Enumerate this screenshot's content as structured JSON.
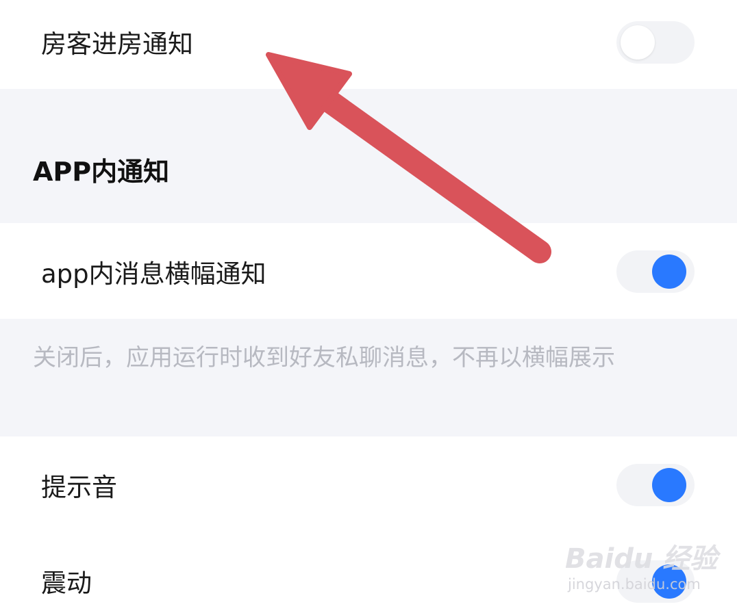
{
  "rows": {
    "guest_checkin": {
      "label": "房客进房通知",
      "toggle": "off"
    },
    "banner": {
      "label": "app内消息横幅通知",
      "toggle": "on"
    },
    "sound": {
      "label": "提示音",
      "toggle": "on"
    },
    "vibrate": {
      "label": "震动",
      "toggle": "on"
    }
  },
  "section": {
    "title": "APP内通知"
  },
  "hint": {
    "text": "关闭后，应用运行时收到好友私聊消息，不再以横幅展示"
  },
  "overlay": {
    "arrow_icon": "red-arrow-icon",
    "arrow_color": "#d9535a"
  },
  "watermark": {
    "brand": "Baidu 经验",
    "url": "jingyan.baidu.com"
  },
  "colors": {
    "toggle_on": "#2979ff",
    "toggle_track": "#f2f3f6",
    "band_bg": "#f4f5f9",
    "hint_text": "#b7b9c1"
  }
}
